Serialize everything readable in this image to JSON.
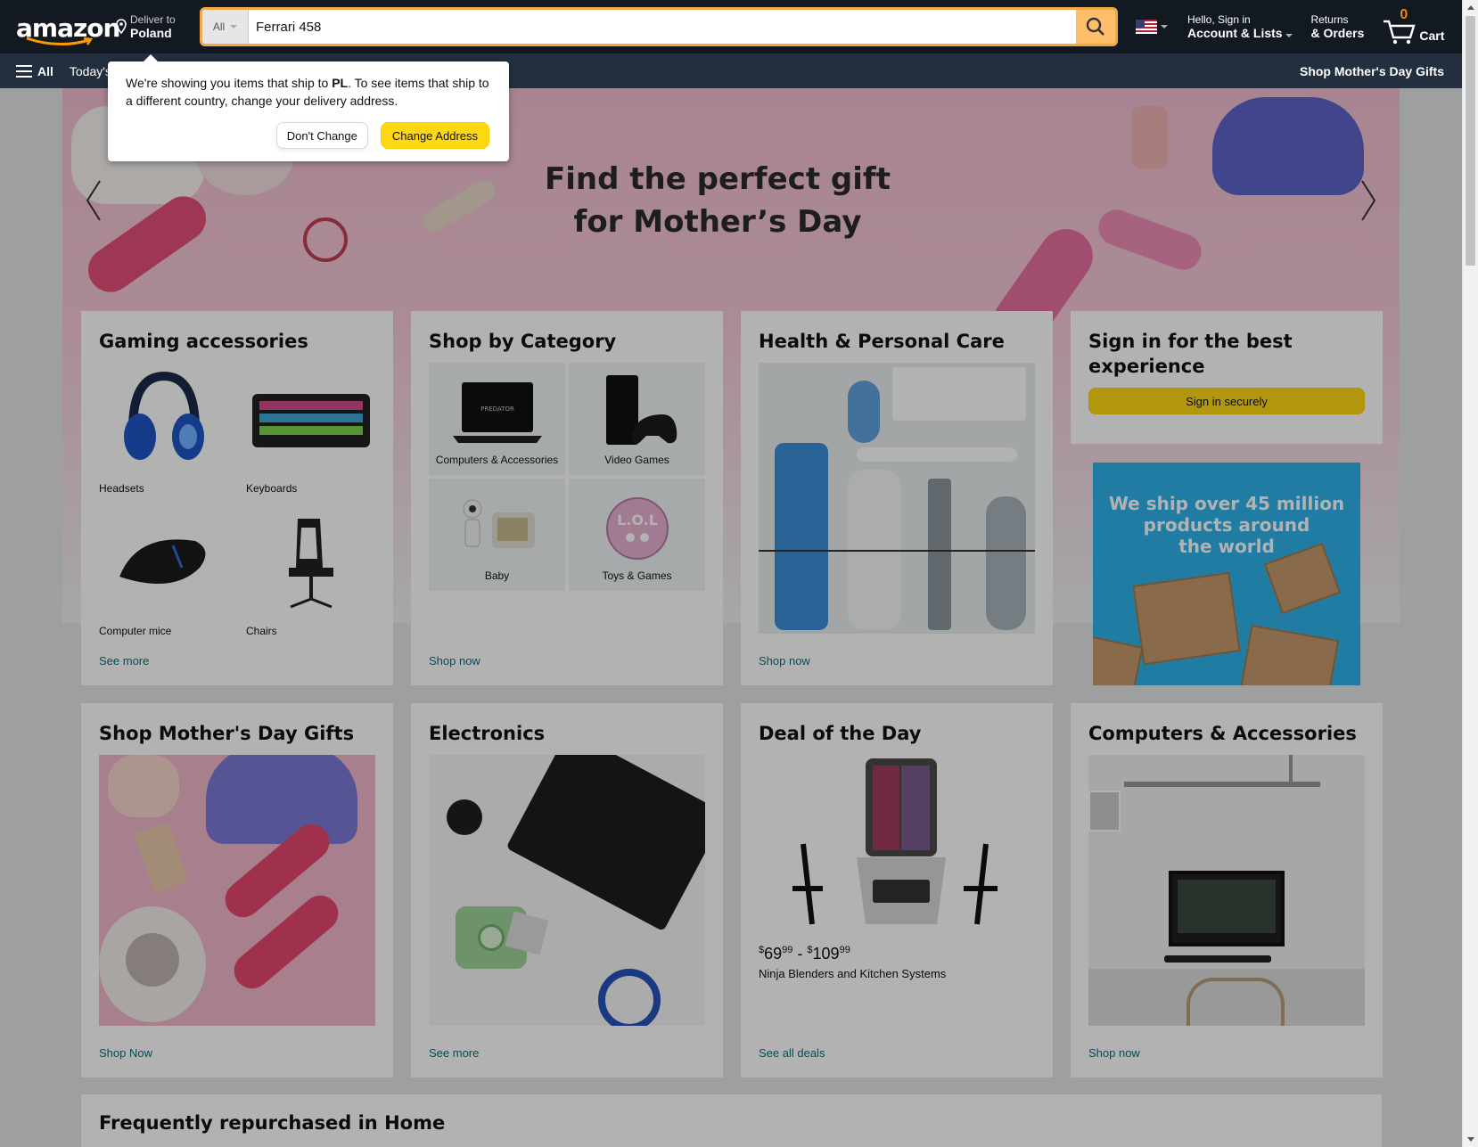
{
  "header": {
    "logo_text": "amazon",
    "deliver": {
      "line1": "Deliver to",
      "line2": "Poland"
    },
    "search": {
      "category": "All",
      "value": "Ferrari 458"
    },
    "account": {
      "line1": "Hello, Sign in",
      "line2": "Account & Lists"
    },
    "orders": {
      "line1": "Returns",
      "line2": "& Orders"
    },
    "cart": {
      "count": "0",
      "label": "Cart"
    },
    "colors": {
      "topbar": "#131921",
      "navbar": "#232f3e",
      "search_button": "#febd69",
      "accent": "#f3a847"
    }
  },
  "navbar": {
    "all_label": "All",
    "first_item": "Today's",
    "right_item": "Shop Mother's Day Gifts"
  },
  "popover": {
    "msg_before": "We're showing you items that ship to ",
    "country": "PL",
    "msg_after": ". To see items that ship to a different country, change your delivery address.",
    "dont_change": "Don't Change",
    "change_address": "Change Address"
  },
  "hero": {
    "title_line1": "Find the perfect gift",
    "title_line2": "for Mother’s Day"
  },
  "cards": {
    "gaming": {
      "title": "Gaming accessories",
      "items": [
        {
          "label": "Headsets",
          "icon": "headset-image"
        },
        {
          "label": "Keyboards",
          "icon": "keyboard-image"
        },
        {
          "label": "Computer mice",
          "icon": "mouse-image"
        },
        {
          "label": "Chairs",
          "icon": "chair-image"
        }
      ],
      "link": "See more"
    },
    "category": {
      "title": "Shop by Category",
      "items": [
        {
          "label": "Computers & Accessories"
        },
        {
          "label": "Video Games"
        },
        {
          "label": "Baby"
        },
        {
          "label": "Toys & Games"
        }
      ],
      "laptop_brand": "PREDATOR",
      "link": "Shop now"
    },
    "health": {
      "title": "Health & Personal Care",
      "link": "Shop now"
    },
    "signin": {
      "title": "Sign in for the best experience",
      "button": "Sign in securely"
    },
    "ship_ad": {
      "line1": "We ship over 45 million",
      "line2": "products around",
      "line3": "the world"
    },
    "mothers": {
      "title": "Shop Mother's Day Gifts",
      "link": "Shop Now"
    },
    "electronics": {
      "title": "Electronics",
      "link": "See more"
    },
    "deal": {
      "title": "Deal of the Day",
      "price_low_dollars": "69",
      "price_low_cents": "99",
      "price_high_dollars": "109",
      "price_high_cents": "99",
      "description": "Ninja Blenders and Kitchen Systems",
      "link": "See all deals"
    },
    "computers": {
      "title": "Computers & Accessories",
      "link": "Shop now"
    }
  },
  "frequently": {
    "title": "Frequently repurchased in Home"
  }
}
